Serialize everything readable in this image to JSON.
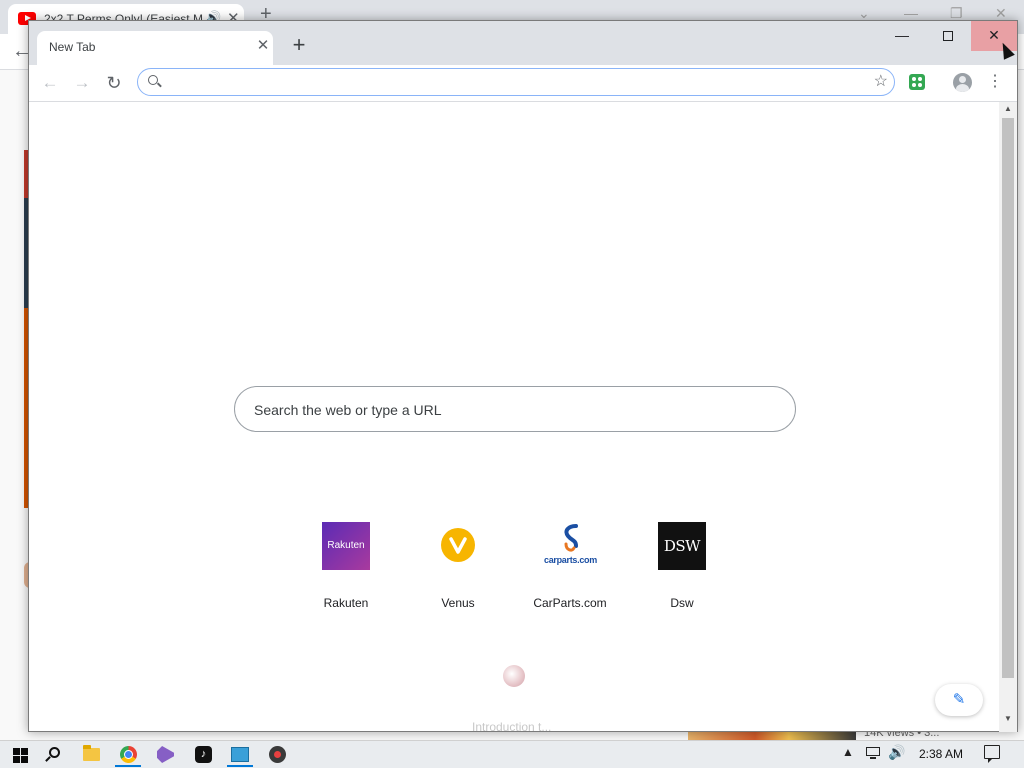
{
  "background_window": {
    "tab_title": "2x2 T Perms Only! (Easiest M",
    "views_text": "14K views • 3..."
  },
  "window": {
    "tab_title": "New Tab",
    "controls": {
      "minimize": "—",
      "close": "✕"
    }
  },
  "toolbar": {
    "omnibox_value": "",
    "back": "←",
    "forward": "→",
    "reload": "↻",
    "star": "☆",
    "menu": "⋮"
  },
  "search": {
    "placeholder": "Search the web or type a URL"
  },
  "shortcuts": [
    {
      "label": "Rakuten",
      "logo_text": "Rakuten"
    },
    {
      "label": "Venus"
    },
    {
      "label": "CarParts.com",
      "logo_text": "carparts.com"
    },
    {
      "label": "Dsw",
      "logo_text": "DSW"
    }
  ],
  "faded_caption": "Introduction t...",
  "taskbar": {
    "clock": "2:38 AM",
    "tiktok_glyph": "♪"
  },
  "colors": {
    "accent": "#1a73e8",
    "close_hover": "#e8a0a4",
    "tab_strip": "#dee1e6",
    "rakuten": "#5b2bb5",
    "venus": "#f7b500",
    "carparts": "#1b4fa3",
    "carparts_accent": "#e87722"
  },
  "icons": {
    "search": "search-icon",
    "star": "star-icon",
    "extension": "extension-icon",
    "profile": "profile-icon",
    "menu": "kebab-menu-icon",
    "customize": "pencil-icon"
  }
}
